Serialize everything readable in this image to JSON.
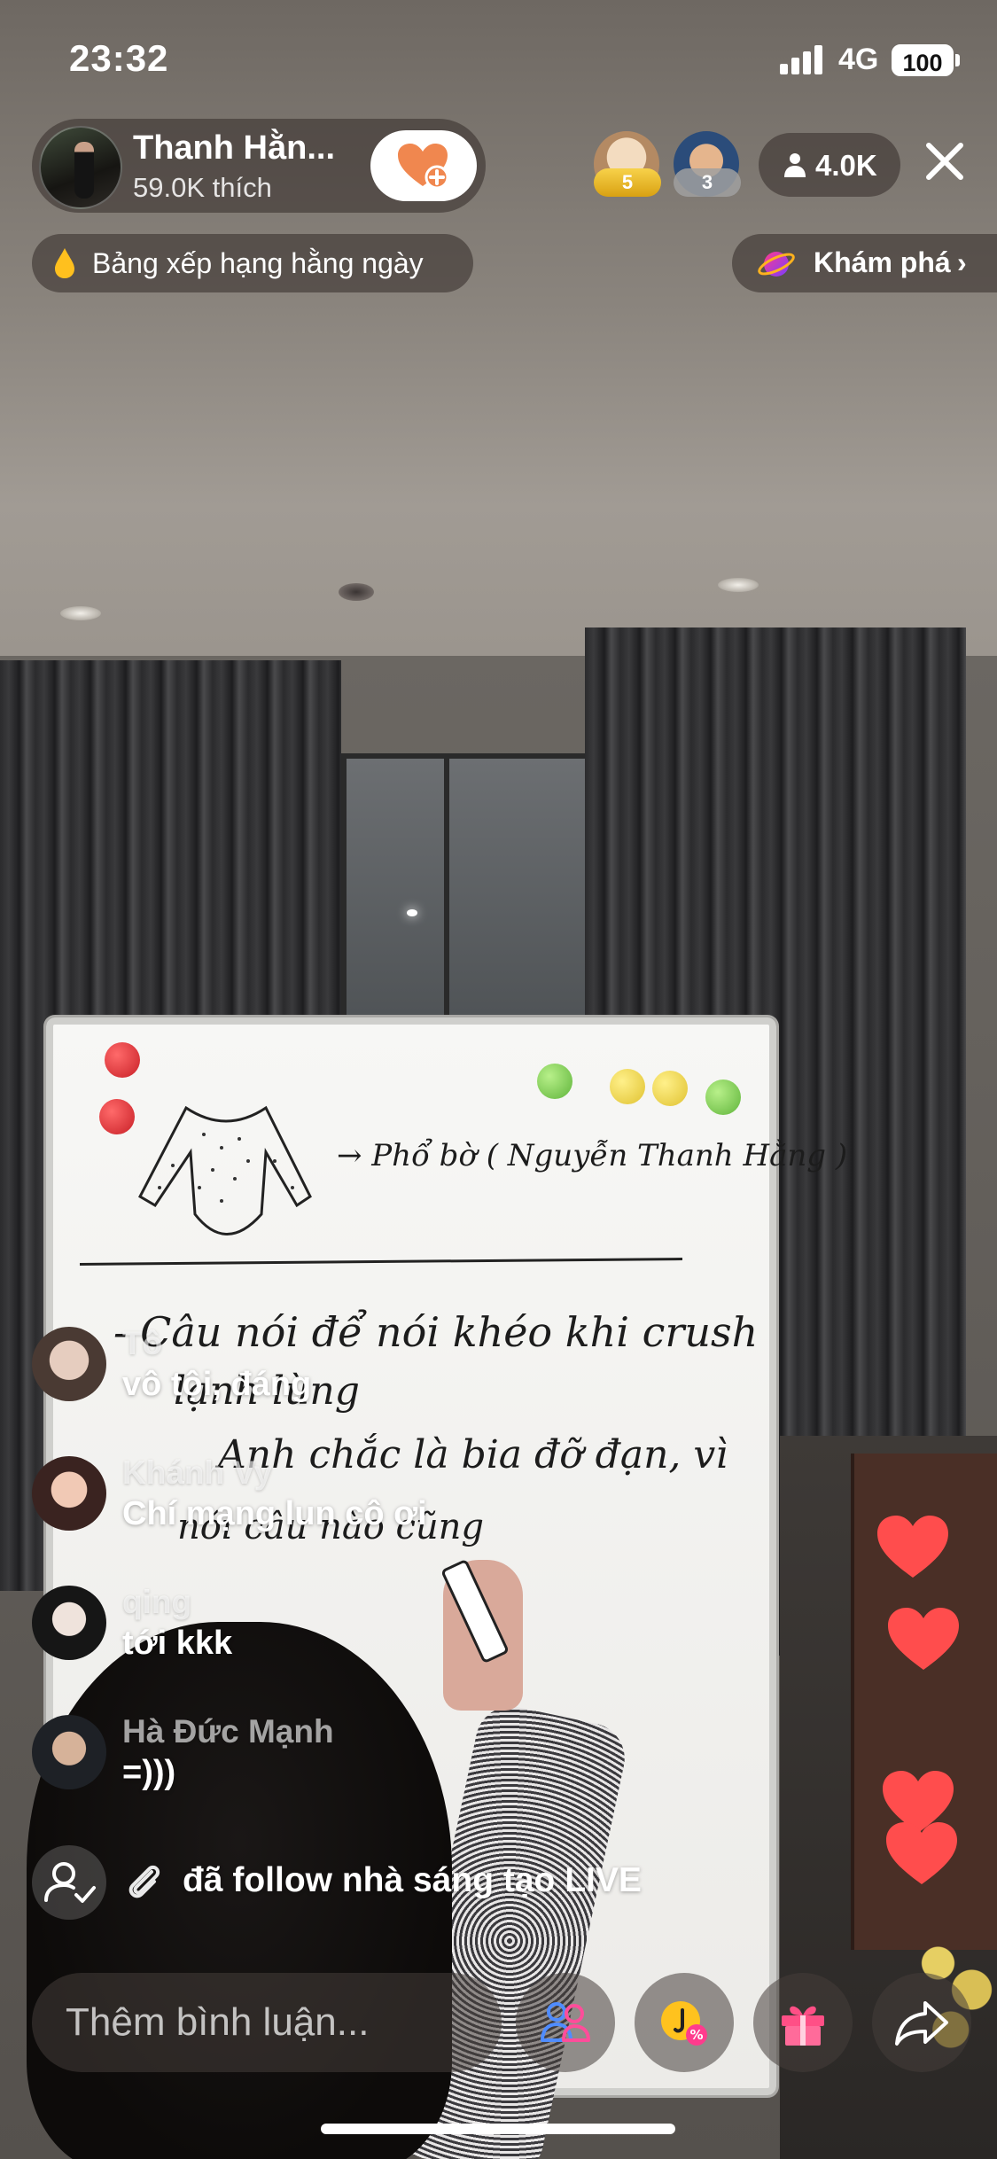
{
  "status_bar": {
    "time": "23:32",
    "network": "4G",
    "battery": "100"
  },
  "host": {
    "name": "Thanh Hằn...",
    "likes": "59.0K thích",
    "follow_icon": "heart-plus-icon"
  },
  "top_viewers": [
    {
      "rank": "5",
      "badge_color": "#f2c12e"
    },
    {
      "rank": "3",
      "badge_color": "#9e9e9e"
    }
  ],
  "viewer_count": "4.0K",
  "ranking": {
    "label": "Bảng xếp hạng hằng ngày",
    "icon": "drop-icon"
  },
  "explore": {
    "label": "Khám phá",
    "chevron": "›",
    "icon": "planet-icon"
  },
  "chat": [
    {
      "user": "Tô",
      "message": "vô tội, đáng"
    },
    {
      "user": "Khánh Vy",
      "message": "Chí mạng lun cô ơi"
    },
    {
      "user": "qing",
      "message": "tới kkk"
    },
    {
      "user": "Hà Đức Mạnh",
      "message": "=)))"
    }
  ],
  "follow_notice": {
    "text": "đã follow nhà sáng tạo LIVE"
  },
  "comment_input": {
    "placeholder": "Thêm bình luận..."
  },
  "actions": [
    "people-icon",
    "coin-icon",
    "gift-icon",
    "share-icon"
  ],
  "whiteboard": {
    "line1": "→ Phổ bờ ( Nguyễn Thanh Hằng )",
    "line2": "- Câu nói để nói khéo khi crush",
    "line3": "lạnh lùng",
    "line4": "Anh chắc là bia đỡ đạn, vì",
    "line5": "nói câu nào cũng"
  },
  "colors": {
    "heart": "#ff4d4d",
    "follow_heart": "#f0874f",
    "overlay": "rgba(60,52,48,0.62)"
  }
}
